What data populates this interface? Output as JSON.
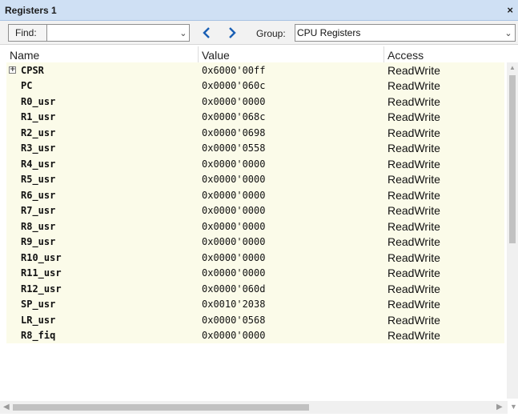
{
  "window": {
    "title": "Registers 1",
    "close_glyph": "×"
  },
  "toolbar": {
    "find_label": "Find:",
    "find_value": "",
    "group_label": "Group:",
    "group_value": "CPU Registers"
  },
  "columns": {
    "name": "Name",
    "value": "Value",
    "access": "Access"
  },
  "rows": [
    {
      "name": "CPSR",
      "value": "0x6000'00ff",
      "access": "ReadWrite",
      "expandable": true
    },
    {
      "name": "PC",
      "value": "0x0000'060c",
      "access": "ReadWrite"
    },
    {
      "name": "R0_usr",
      "value": "0x0000'0000",
      "access": "ReadWrite"
    },
    {
      "name": "R1_usr",
      "value": "0x0000'068c",
      "access": "ReadWrite"
    },
    {
      "name": "R2_usr",
      "value": "0x0000'0698",
      "access": "ReadWrite"
    },
    {
      "name": "R3_usr",
      "value": "0x0000'0558",
      "access": "ReadWrite"
    },
    {
      "name": "R4_usr",
      "value": "0x0000'0000",
      "access": "ReadWrite"
    },
    {
      "name": "R5_usr",
      "value": "0x0000'0000",
      "access": "ReadWrite"
    },
    {
      "name": "R6_usr",
      "value": "0x0000'0000",
      "access": "ReadWrite"
    },
    {
      "name": "R7_usr",
      "value": "0x0000'0000",
      "access": "ReadWrite"
    },
    {
      "name": "R8_usr",
      "value": "0x0000'0000",
      "access": "ReadWrite"
    },
    {
      "name": "R9_usr",
      "value": "0x0000'0000",
      "access": "ReadWrite"
    },
    {
      "name": "R10_usr",
      "value": "0x0000'0000",
      "access": "ReadWrite"
    },
    {
      "name": "R11_usr",
      "value": "0x0000'0000",
      "access": "ReadWrite"
    },
    {
      "name": "R12_usr",
      "value": "0x0000'060d",
      "access": "ReadWrite"
    },
    {
      "name": "SP_usr",
      "value": "0x0010'2038",
      "access": "ReadWrite"
    },
    {
      "name": "LR_usr",
      "value": "0x0000'0568",
      "access": "ReadWrite"
    },
    {
      "name": "R8_fiq",
      "value": "0x0000'0000",
      "access": "ReadWrite"
    }
  ],
  "colors": {
    "titlebar": "#cfe0f4",
    "row_background": "#fbfbe9",
    "nav_arrow": "#1a5fb4"
  },
  "icons": {
    "expand": "plus-box-icon",
    "find_dropdown": "chevron-down-icon",
    "prev": "chevron-left-icon",
    "next": "chevron-right-icon",
    "group_dropdown": "chevron-down-icon"
  }
}
